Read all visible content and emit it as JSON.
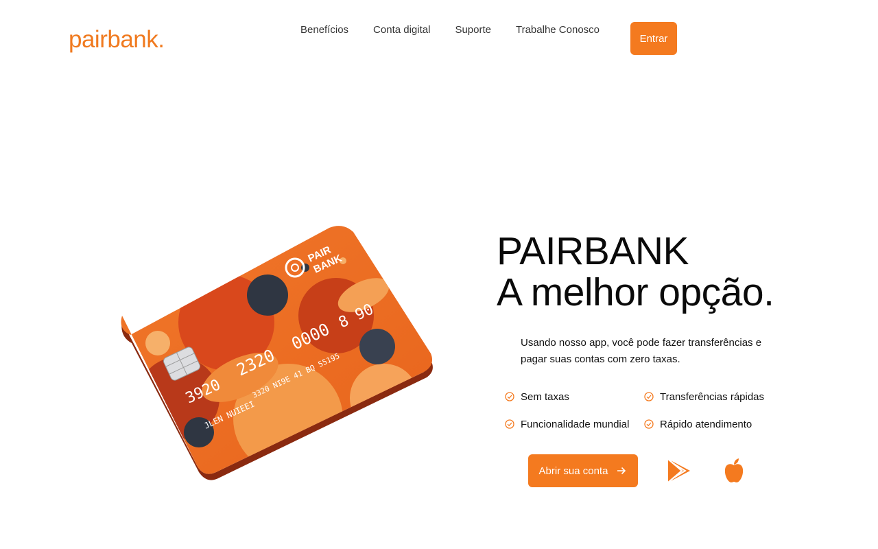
{
  "brand": {
    "logo": "pairbank."
  },
  "nav": {
    "items": [
      "Benefícios",
      "Conta digital",
      "Suporte",
      "Trabalhe Conosco"
    ],
    "login": "Entrar"
  },
  "card": {
    "brand_line1": "PAIR",
    "brand_line2": "BANK",
    "number_a": "3920",
    "number_b": "2320",
    "number_c": "0000",
    "number_d": "8 90",
    "line2": "3320  NI9E  41 BQ  55195",
    "name": "JLEN NUIEEI"
  },
  "hero": {
    "title_line1": "PAIRBANK",
    "title_line2": "A melhor opção.",
    "description": "Usando nosso app, você pode fazer transferências e pagar suas contas com zero taxas.",
    "features": [
      "Sem taxas",
      "Transferências rápidas",
      "Funcionalidade mundial",
      "Rápido atendimento"
    ],
    "cta": "Abrir sua conta"
  },
  "icons": {
    "feature": "check-circle-icon",
    "cta": "arrow-right-icon",
    "store1": "google-play-icon",
    "store2": "apple-icon"
  },
  "colors": {
    "accent": "#f47a1f",
    "text": "#111111"
  }
}
